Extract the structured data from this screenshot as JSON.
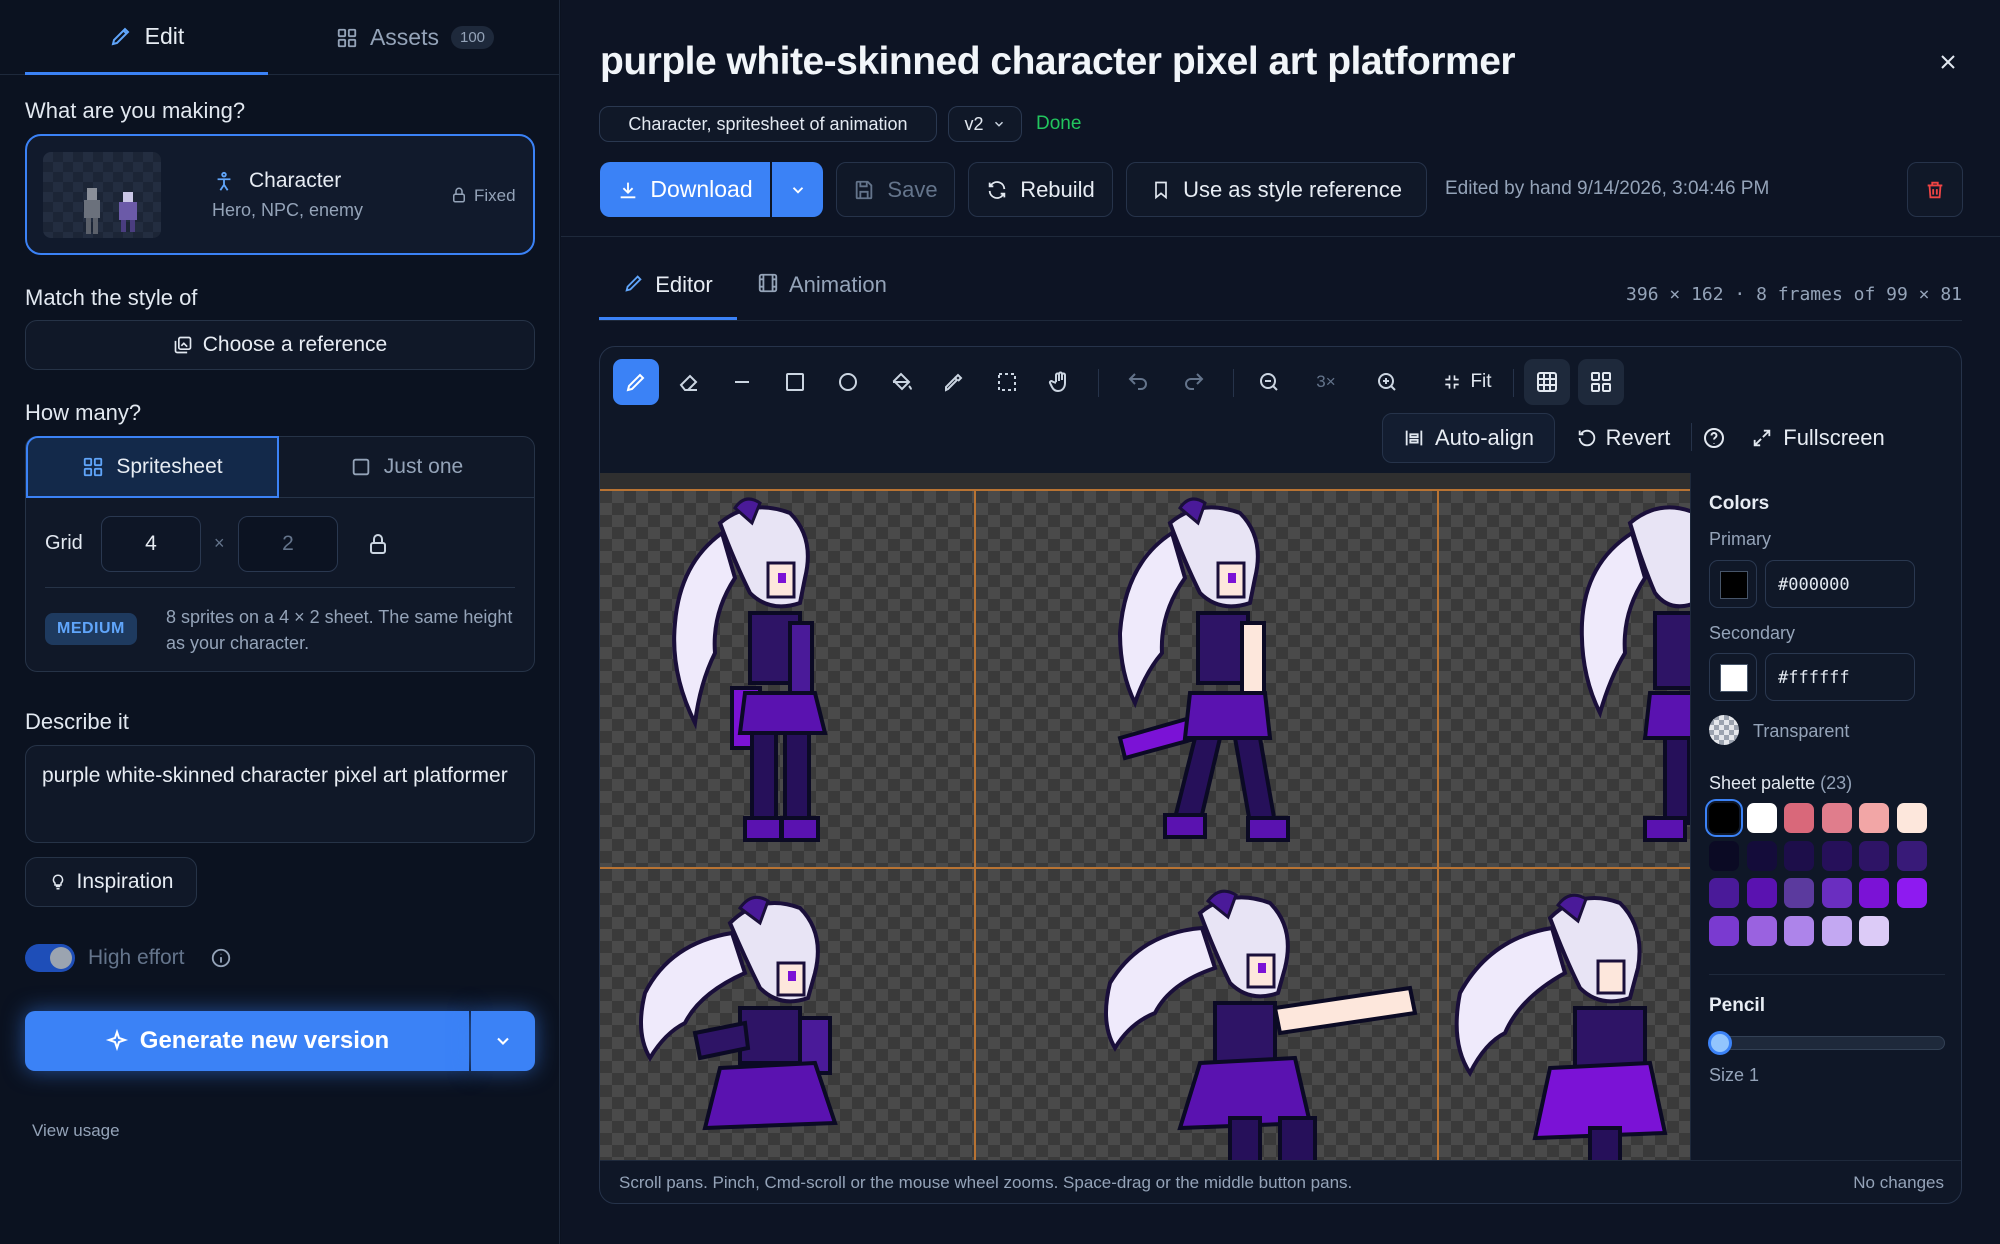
{
  "sidebar": {
    "tabs": {
      "edit": "Edit",
      "assets": "Assets",
      "assets_count": "100"
    },
    "making_label": "What are you making?",
    "type_card": {
      "title": "Character",
      "subtitle": "Hero, NPC, enemy",
      "fixed": "Fixed"
    },
    "match_label": "Match the style of",
    "choose_reference": "Choose a reference",
    "how_many_label": "How many?",
    "mode": {
      "spritesheet": "Spritesheet",
      "just_one": "Just one",
      "selected": "Spritesheet"
    },
    "grid": {
      "label": "Grid",
      "cols": "4",
      "times": "×",
      "rows_placeholder": "2"
    },
    "size_badge": "MEDIUM",
    "size_desc": "8 sprites on a 4 × 2 sheet. The same height as your character.",
    "describe_label": "Describe it",
    "description": "purple white-skinned character pixel art platformer",
    "inspiration": "Inspiration",
    "high_effort": {
      "label": "High effort",
      "enabled": true
    },
    "generate": "Generate new version",
    "view_usage": "View usage"
  },
  "header": {
    "title": "purple white-skinned character pixel art platformer",
    "type_chip": "Character, spritesheet of animation",
    "version": "v2",
    "status": "Done",
    "download": "Download",
    "save": "Save",
    "rebuild": "Rebuild",
    "style_ref": "Use as style reference",
    "edited": "Edited by hand 9/14/2026, 3:04:46 PM"
  },
  "view_tabs": {
    "editor": "Editor",
    "animation": "Animation",
    "selected": "Editor"
  },
  "sheet_info": "396 × 162 · 8 frames of 99 × 81",
  "toolbar": {
    "zoom": "3×",
    "fit": "Fit",
    "auto_align": "Auto-align",
    "revert": "Revert",
    "fullscreen": "Fullscreen",
    "tools": [
      "pencil-icon",
      "eraser-icon",
      "line-icon",
      "rectangle-icon",
      "circle-icon",
      "fill-bucket-icon",
      "eyedropper-icon",
      "select-icon",
      "hand-icon"
    ]
  },
  "colors": {
    "title": "Colors",
    "primary_label": "Primary",
    "primary": "#000000",
    "secondary_label": "Secondary",
    "secondary": "#ffffff",
    "transparent": "Transparent",
    "palette_label": "Sheet palette",
    "palette_count": "(23)",
    "palette": [
      "#000000",
      "#ffffff",
      "#d9687a",
      "#e07d8c",
      "#f2a6a6",
      "#fde7dc",
      "#0b0a24",
      "#140c3a",
      "#1d0e4a",
      "#26105a",
      "#2e1466",
      "#381a78",
      "#4a1a99",
      "#5a12b0",
      "#5b3a9e",
      "#6a2ec0",
      "#7b12d6",
      "#8e1af0",
      "#7a3ad0",
      "#9a62e0",
      "#ad84ea",
      "#c3a8f2",
      "#dccbf7"
    ]
  },
  "pencil": {
    "title": "Pencil",
    "size_label": "Size 1",
    "size": 1
  },
  "footer": {
    "hint": "Scroll pans. Pinch, Cmd-scroll or the mouse wheel zooms. Space-drag or the middle button pans.",
    "changes": "No changes"
  }
}
